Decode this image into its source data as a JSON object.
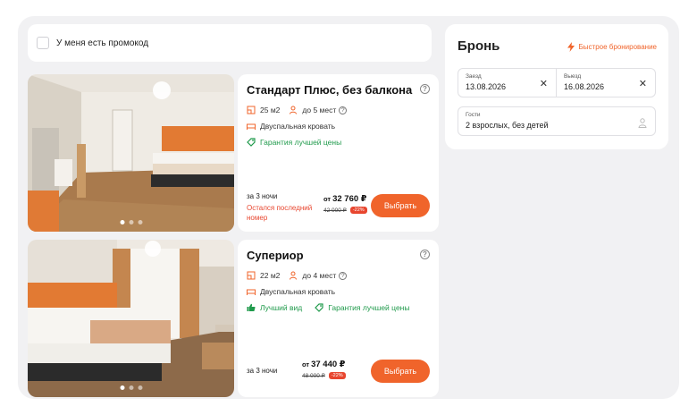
{
  "promo": {
    "label": "У меня есть промокод"
  },
  "booking": {
    "title": "Бронь",
    "fast_booking": "Быстрое бронирование",
    "check_in": {
      "label": "Заезд",
      "value": "13.08.2026"
    },
    "check_out": {
      "label": "Выезд",
      "value": "16.08.2026"
    },
    "guests": {
      "label": "Гости",
      "value": "2 взрослых, без детей"
    }
  },
  "rooms": [
    {
      "title": "Стандарт Плюс, без балкона",
      "area": "25 м2",
      "capacity": "до 5 мест",
      "bed": "Двуспальная кровать",
      "badges": [
        "Гарантия лучшей цены"
      ],
      "nights": "за 3 ночи",
      "warning": "Остался последний номер",
      "price_prefix": "от",
      "price": "32 760 ₽",
      "old_price": "42 000 ₽",
      "discount": "-22%",
      "button": "Выбрать"
    },
    {
      "title": "Супериор",
      "area": "22 м2",
      "capacity": "до 4 мест",
      "bed": "Двуспальная кровать",
      "badges": [
        "Лучший вид",
        "Гарантия лучшей цены"
      ],
      "nights": "за 3 ночи",
      "warning": "",
      "price_prefix": "от",
      "price": "37 440 ₽",
      "old_price": "48 000 ₽",
      "discount": "-22%",
      "button": "Выбрать"
    }
  ],
  "colors": {
    "accent": "#f0642b",
    "green": "#1f9a4b",
    "danger": "#e8462f"
  }
}
